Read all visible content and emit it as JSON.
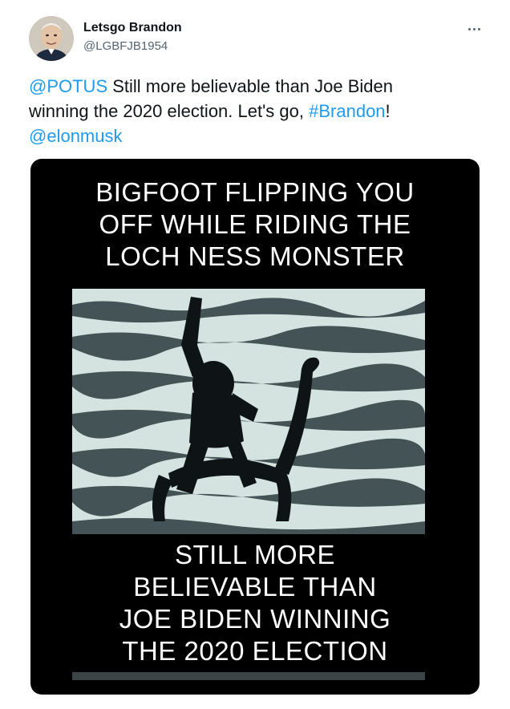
{
  "author": {
    "name": "Letsgo Brandon",
    "handle": "@LGBFJB1954",
    "avatar_icon": "user-avatar-icon"
  },
  "more_icon": "ellipsis-icon",
  "tweet_text": {
    "mention_1": "@POTUS",
    "line_1_rest": " Still more believable than Joe Biden",
    "line_2_start": "winning the 2020 election. Let's go, ",
    "hashtag": "#Brandon",
    "line_2_end": "!",
    "mention_2": "@elonmusk"
  },
  "media": {
    "top_caption": [
      "BIGFOOT FLIPPING YOU",
      "OFF WHILE RIDING THE",
      "LOCH NESS MONSTER"
    ],
    "bottom_caption": [
      "STILL MORE",
      "BELIEVABLE THAN",
      "JOE BIDEN WINNING",
      "THE 2020 ELECTION"
    ]
  },
  "colors": {
    "link": "#1d9bf0",
    "text": "#0f1419",
    "secondary": "#536471",
    "media_bg": "#000000"
  }
}
